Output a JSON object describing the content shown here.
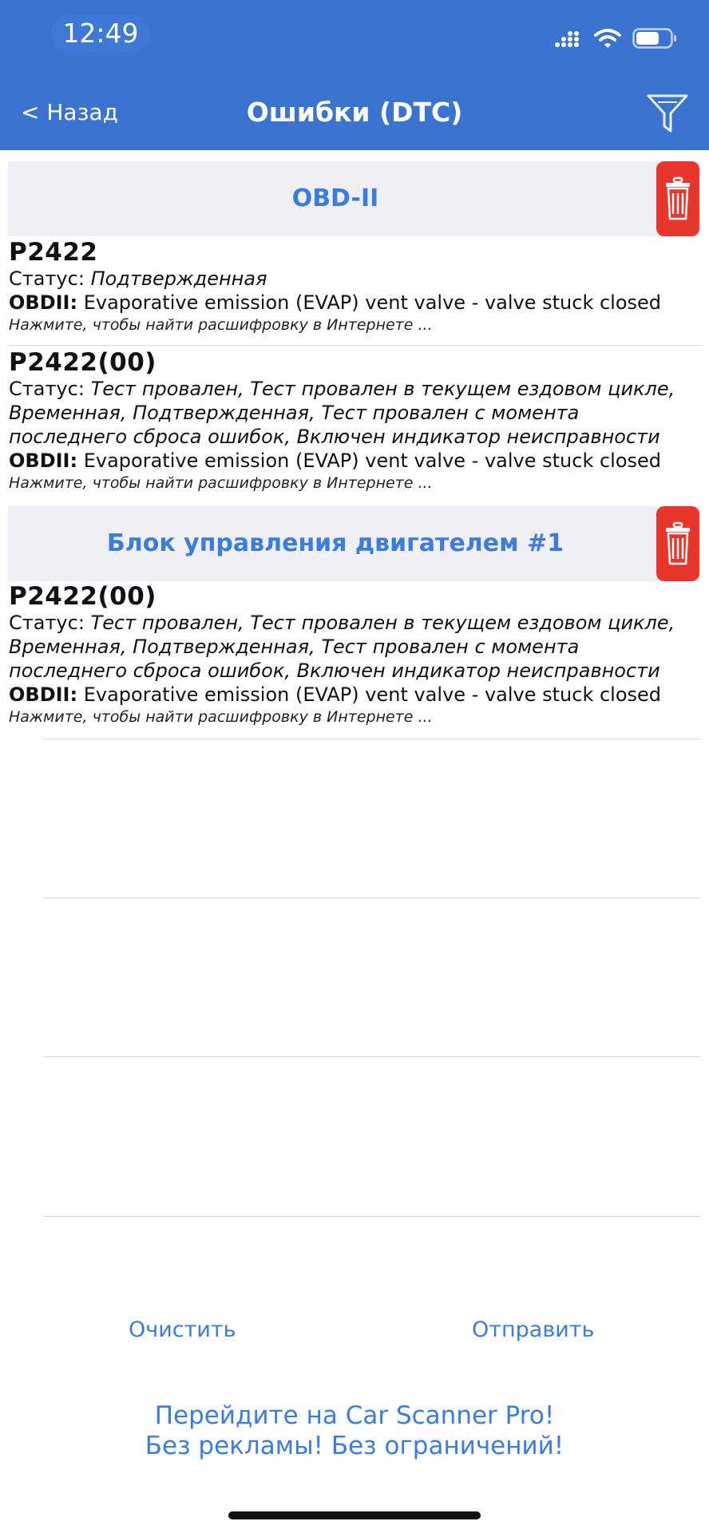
{
  "status_bar": {
    "time": "12:49",
    "icons": [
      "signal-icon",
      "wifi-icon",
      "battery-icon"
    ]
  },
  "nav": {
    "back_label": "< Назад",
    "title": "Ошибки (DTC)",
    "filter_icon": "filter-icon"
  },
  "sections": [
    {
      "title": "OBD-II",
      "items": [
        {
          "code": "P2422",
          "status_label": "Статус:",
          "status": "Подтвержденная",
          "obd_label": "OBDII:",
          "description": "Evaporative emission (EVAP) vent valve - valve stuck closed",
          "hint": "Нажмите, чтобы найти расшифровку в Интернете ..."
        },
        {
          "code": "P2422(00)",
          "status_label": "Статус:",
          "status_lines": [
            "Тест провален, Тест провален в текущем ездовом цикле,",
            "Временная, Подтвержденная, Тест провален с момента",
            "последнего сброса ошибок, Включен индикатор неисправности"
          ],
          "obd_label": "OBDII:",
          "description": "Evaporative emission (EVAP) vent valve - valve stuck closed",
          "hint": "Нажмите, чтобы найти расшифровку в Интернете ..."
        }
      ]
    },
    {
      "title": "Блок управления двигателем #1",
      "items": [
        {
          "code": "P2422(00)",
          "status_label": "Статус:",
          "status_lines": [
            "Тест провален, Тест провален в текущем ездовом цикле,",
            "Временная, Подтвержденная, Тест провален с момента",
            "последнего сброса ошибок, Включен индикатор неисправности"
          ],
          "obd_label": "OBDII:",
          "description": "Evaporative emission (EVAP) vent valve - valve stuck closed",
          "hint": "Нажмите, чтобы найти расшифровку в Интернете ..."
        }
      ]
    }
  ],
  "actions": {
    "clear_label": "Очистить",
    "send_label": "Отправить"
  },
  "promo": {
    "line1": "Перейдите на Car Scanner Pro!",
    "line2": "Без рекламы! Без ограничений!"
  },
  "colors": {
    "header": "#3a73d0",
    "accent": "#3b7ce0",
    "delete": "#e8362d",
    "section_bg": "#efeff4"
  }
}
